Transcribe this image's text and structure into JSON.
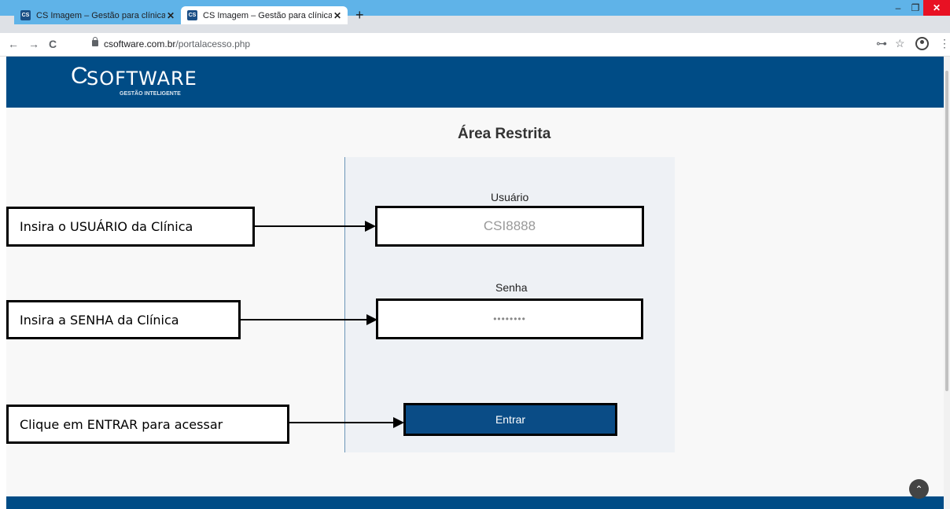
{
  "browser": {
    "tabs": [
      {
        "favicon": "CS",
        "title": "CS Imagem – Gestão para clínicas",
        "close": "✕"
      },
      {
        "favicon": "CS",
        "title": "CS Imagem – Gestão para clínicas",
        "close": "✕"
      }
    ],
    "new_tab": "+",
    "window_controls": {
      "minimize": "–",
      "maximize": "❐",
      "close": "✕"
    },
    "nav": {
      "back": "←",
      "forward": "→",
      "reload": "C"
    },
    "url_host": "csoftware.com.br",
    "url_path": "/portalacesso.php",
    "toolbar_icons": {
      "key": "⊶",
      "star": "☆",
      "menu": "⋮"
    }
  },
  "header": {
    "logo_mark": "C",
    "logo_word": "SOFTWARE",
    "logo_tagline": "GESTÃO INTELIGENTE",
    "color": "#004c86"
  },
  "login": {
    "title": "Área Restrita",
    "username_label": "Usuário",
    "username_value": "CSI8888",
    "password_label": "Senha",
    "password_value": "••••••••",
    "submit_label": "Entrar"
  },
  "annotations": {
    "user_callout": "Insira o USUÁRIO da Clínica",
    "password_callout": "Insira a SENHA da Clínica",
    "enter_callout": "Clique em ENTRAR para acessar"
  },
  "scroll_top_icon": "⌃"
}
